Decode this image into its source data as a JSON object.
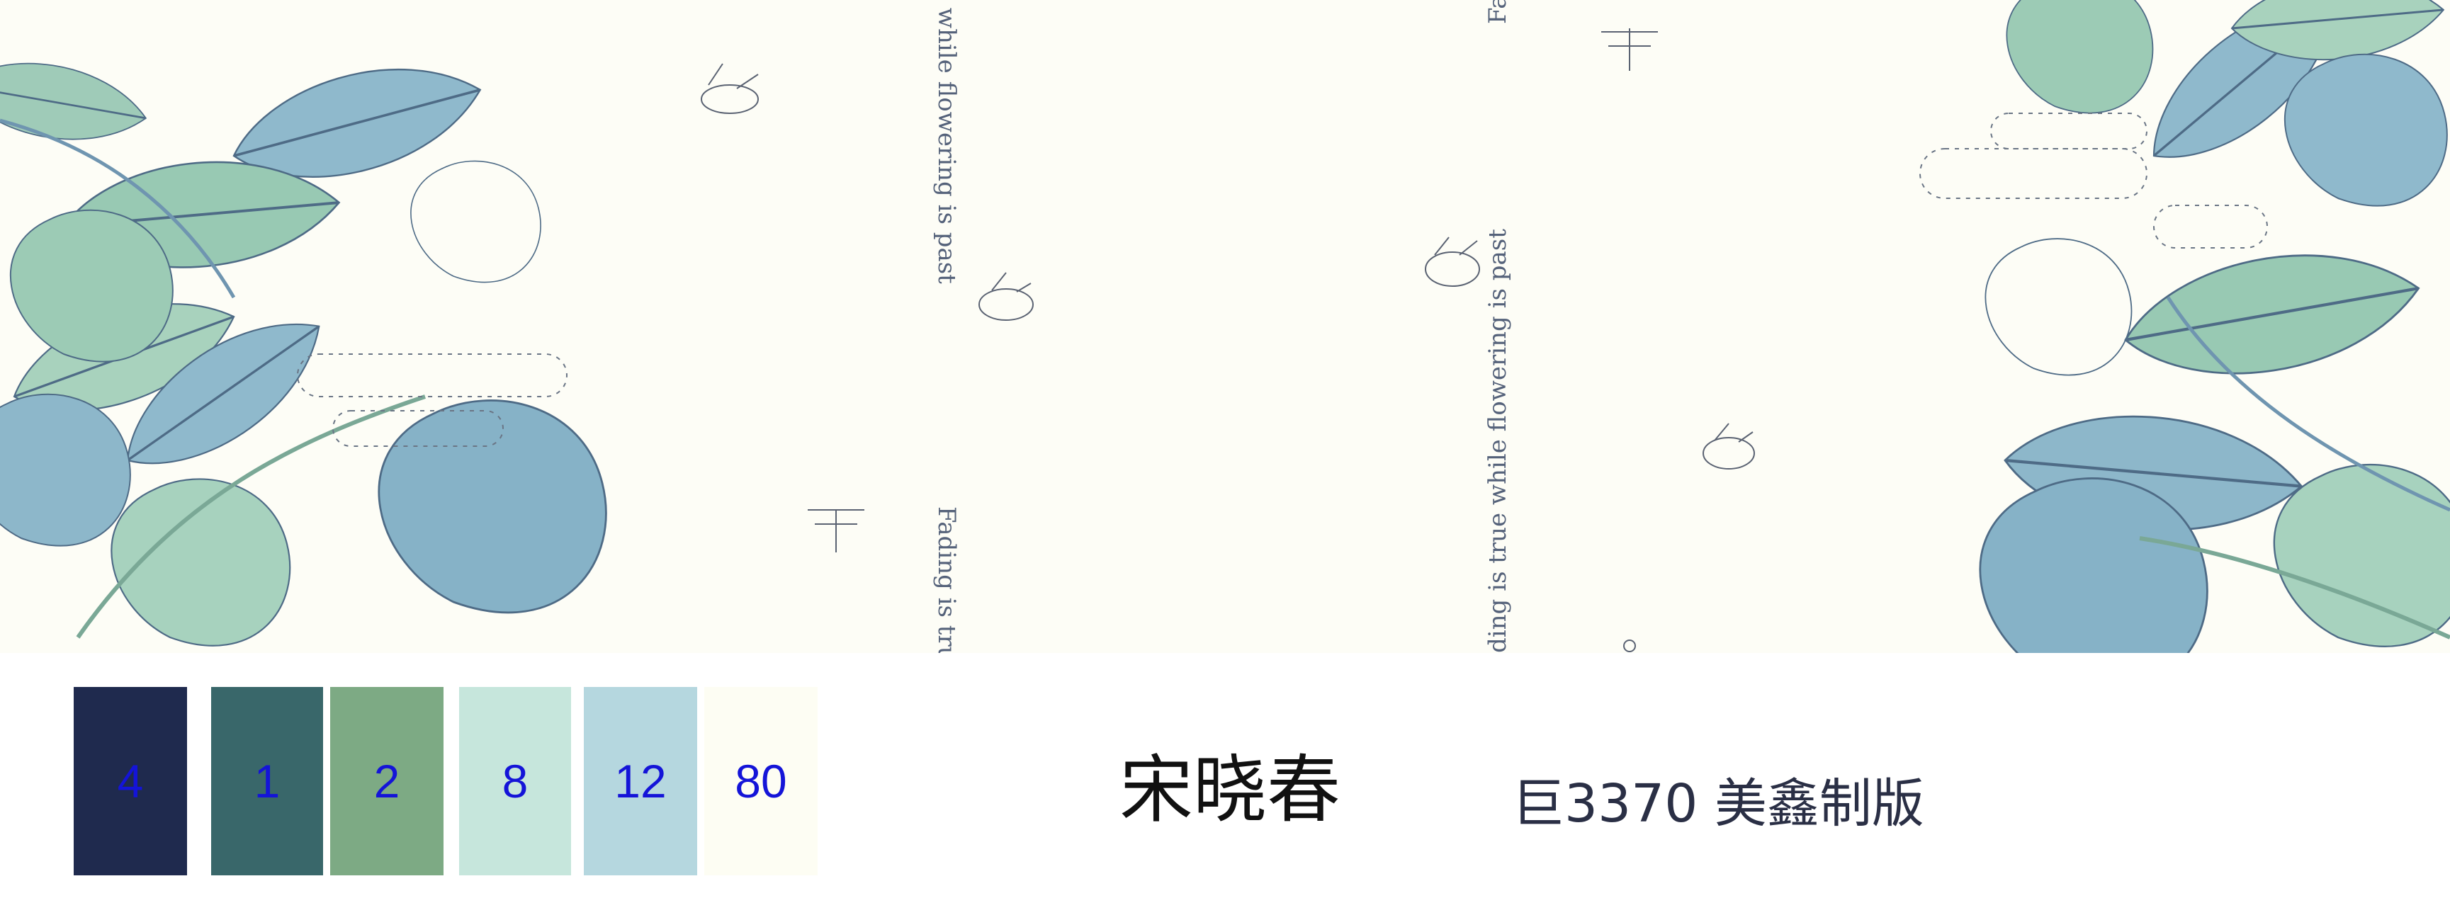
{
  "pattern": {
    "text_runs": [
      "e while flowering is past",
      "Fading is tru",
      "ding is true while flowering is past",
      "Fa"
    ]
  },
  "palette": [
    {
      "label": "4",
      "color": "#1f2a4e"
    },
    {
      "label": "1",
      "color": "#39676a"
    },
    {
      "label": "2",
      "color": "#7daa84"
    },
    {
      "label": "8",
      "color": "#c6e6dc"
    },
    {
      "label": "12",
      "color": "#b5d7df"
    },
    {
      "label": "80",
      "color": "#fdfdf3"
    }
  ],
  "designer_name": "宋晓春",
  "plate_info": "巨3370  美鑫制版"
}
